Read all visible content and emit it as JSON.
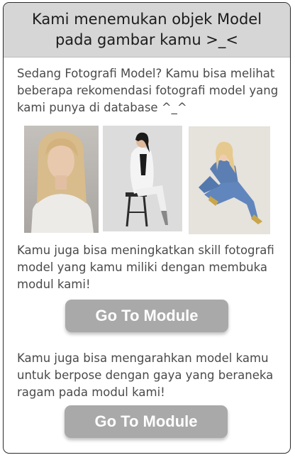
{
  "header": {
    "title_line1": "Kami menemukan objek Model",
    "title_line2": "pada gambar kamu >_<"
  },
  "intro": "Sedang Fotografi Model? Kamu bisa melihat beberapa rekomendasi fotografi model yang kami punya di database ^_^",
  "photos": [
    {
      "name": "model-photo-blonde-white-tee"
    },
    {
      "name": "model-photo-white-suit-stool"
    },
    {
      "name": "model-photo-blue-suit-crouch"
    }
  ],
  "section1": {
    "text": "Kamu juga bisa meningkatkan skill fotografi model yang kamu miliki dengan membuka modul kami!",
    "button_label": "Go To Module"
  },
  "section2": {
    "text": "Kamu juga bisa mengarahkan model kamu untuk berpose dengan gaya yang beraneka ragam pada modul kami!",
    "button_label": "Go To Module"
  },
  "colors": {
    "header_bg": "#d6d6d6",
    "button_bg": "#a9a9a9",
    "text": "#4a4a4a"
  }
}
